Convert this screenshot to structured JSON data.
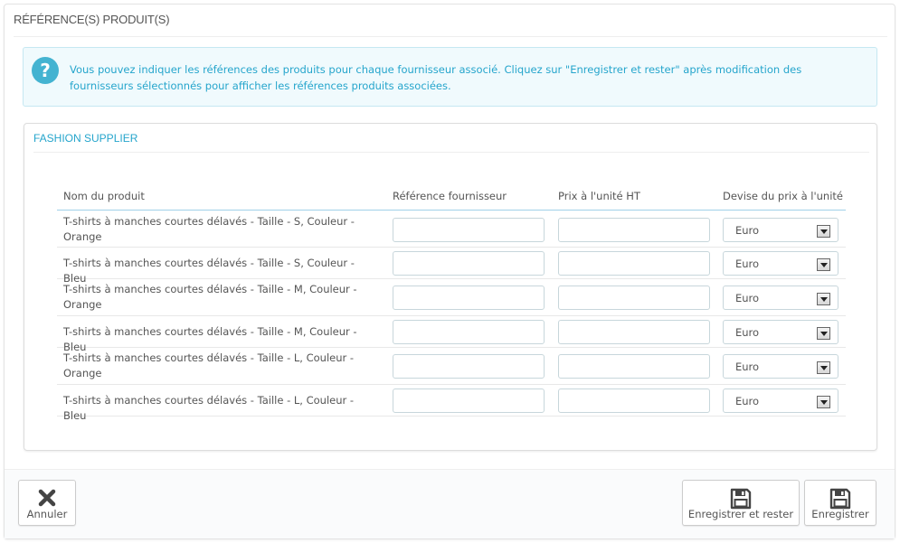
{
  "panel": {
    "title": "RÉFÉRENCE(S) PRODUIT(S)"
  },
  "alert": {
    "icon": "question-icon",
    "text": "Vous pouvez indiquer les références des produits pour chaque fournisseur associé. Cliquez sur \"Enregistrer et rester\" après modification des fournisseurs sélectionnés pour afficher les références produits associées."
  },
  "supplier": {
    "title": "FASHION SUPPLIER",
    "headers": {
      "name": "Nom du produit",
      "reference": "Référence fournisseur",
      "price": "Prix à l'unité HT",
      "currency": "Devise du prix à l'unité"
    },
    "rows": [
      {
        "name": "T-shirts à manches courtes délavés - Taille - S, Couleur - Orange",
        "reference": "",
        "price": "",
        "currency": "Euro"
      },
      {
        "name": "T-shirts à manches courtes délavés - Taille - S, Couleur - Bleu",
        "reference": "",
        "price": "",
        "currency": "Euro"
      },
      {
        "name": "T-shirts à manches courtes délavés - Taille - M, Couleur - Orange",
        "reference": "",
        "price": "",
        "currency": "Euro"
      },
      {
        "name": "T-shirts à manches courtes délavés - Taille - M, Couleur - Bleu",
        "reference": "",
        "price": "",
        "currency": "Euro"
      },
      {
        "name": "T-shirts à manches courtes délavés - Taille - L, Couleur - Orange",
        "reference": "",
        "price": "",
        "currency": "Euro"
      },
      {
        "name": "T-shirts à manches courtes délavés - Taille - L, Couleur - Bleu",
        "reference": "",
        "price": "",
        "currency": "Euro"
      }
    ]
  },
  "footer": {
    "cancel_label": "Annuler",
    "save_stay_label": "Enregistrer et rester",
    "save_label": "Enregistrer"
  },
  "colors": {
    "accent": "#25a5cc",
    "alert_bg": "#f0fafd",
    "alert_icon": "#44b3d1"
  }
}
